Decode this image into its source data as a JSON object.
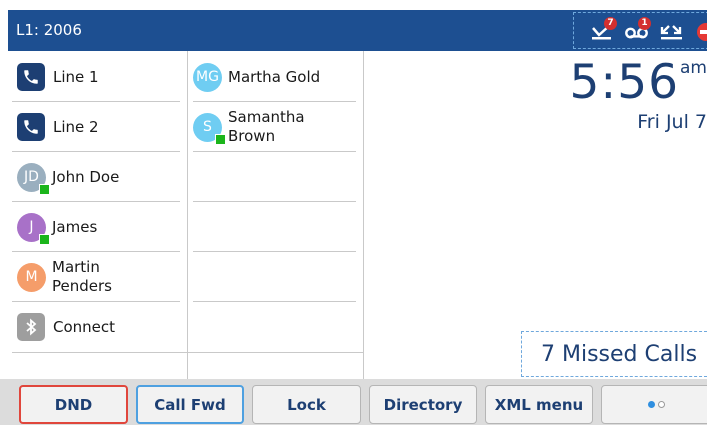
{
  "header": {
    "line_label": "L1: 2006",
    "missed_badge": "7",
    "voicemail_badge": "1"
  },
  "colors": {
    "header_bg": "#1d4f91",
    "text_blue": "#1d3f73",
    "presence_green": "#1bb51b",
    "dnd_red": "#e53935"
  },
  "line_keys_left": [
    {
      "type": "line",
      "label": "Line 1",
      "icon": "phone-icon"
    },
    {
      "type": "line",
      "label": "Line 2",
      "icon": "phone-icon"
    },
    {
      "type": "contact",
      "initials": "JD",
      "name": "John Doe",
      "avatar_color": "#9aafbf",
      "presence": "available"
    },
    {
      "type": "contact",
      "initials": "J",
      "name": "James",
      "avatar_color": "#a871c8",
      "presence": "available"
    },
    {
      "type": "contact",
      "initials": "M",
      "name_line1": "Martin",
      "name_line2": "Penders",
      "avatar_color": "#f59d6a"
    },
    {
      "type": "bluetooth",
      "label": "Connect",
      "icon": "bluetooth-icon"
    }
  ],
  "line_keys_right": [
    {
      "type": "contact",
      "initials": "MG",
      "name": "Martha Gold",
      "avatar_color": "#6fcdf2"
    },
    {
      "type": "contact",
      "initials": "S",
      "name_line1": "Samantha",
      "name_line2": "Brown",
      "avatar_color": "#6fcdf2",
      "presence": "available"
    }
  ],
  "clock": {
    "time": "5:56",
    "ampm": "am",
    "date": "Fri Jul 7"
  },
  "missed_calls": {
    "text": "7  Missed Calls"
  },
  "softkeys": {
    "dnd": "DND",
    "call_fwd": "Call Fwd",
    "lock": "Lock",
    "directory": "Directory",
    "xml_menu": "XML menu"
  }
}
